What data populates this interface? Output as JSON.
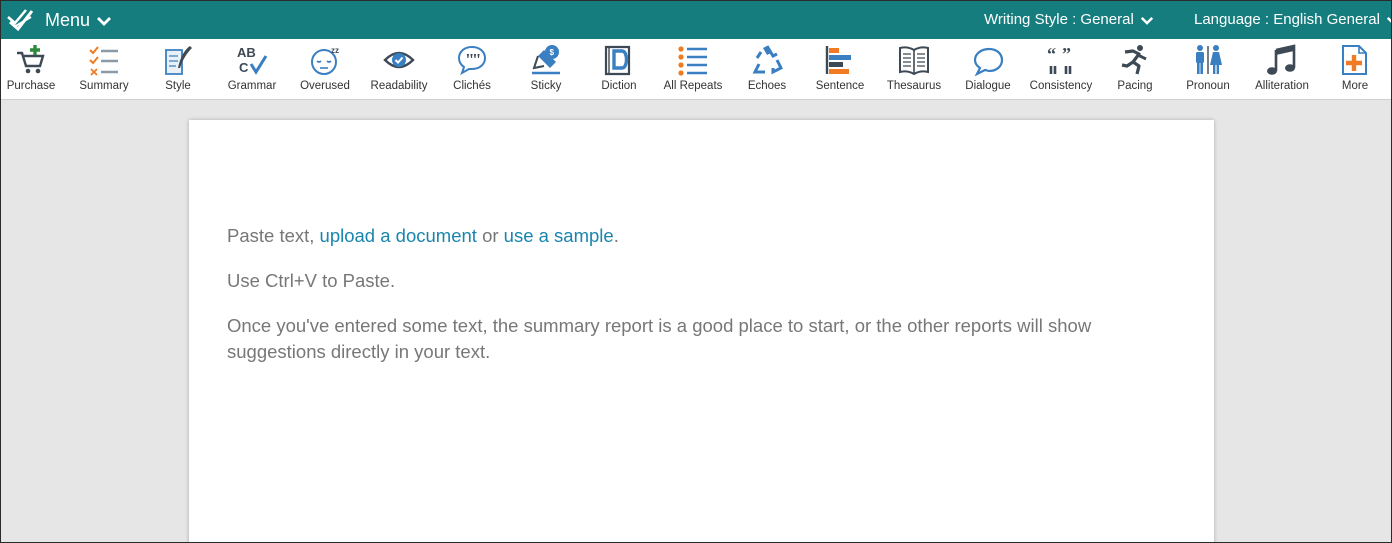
{
  "topbar": {
    "menu_label": "Menu",
    "writing_style_label": "Writing Style : General",
    "language_label": "Language : English General",
    "bar_color": "#167d7f"
  },
  "toolbar": {
    "items": [
      {
        "label": "Purchase",
        "icon": "cart-plus-icon"
      },
      {
        "label": "Summary",
        "icon": "checklist-icon"
      },
      {
        "label": "Style",
        "icon": "quill-page-icon"
      },
      {
        "label": "Grammar",
        "icon": "abc-check-icon"
      },
      {
        "label": "Overused",
        "icon": "sleepy-face-icon"
      },
      {
        "label": "Readability",
        "icon": "eye-icon"
      },
      {
        "label": "Clichés",
        "icon": "quote-bubble-icon"
      },
      {
        "label": "Sticky",
        "icon": "glue-pen-icon"
      },
      {
        "label": "Diction",
        "icon": "dictionary-book-icon"
      },
      {
        "label": "All Repeats",
        "icon": "list-icon"
      },
      {
        "label": "Echoes",
        "icon": "recycle-icon"
      },
      {
        "label": "Sentence",
        "icon": "bar-lines-icon"
      },
      {
        "label": "Thesaurus",
        "icon": "open-book-icon"
      },
      {
        "label": "Dialogue",
        "icon": "speech-bubble-icon"
      },
      {
        "label": "Consistency",
        "icon": "quote-marks-icon"
      },
      {
        "label": "Pacing",
        "icon": "runner-icon"
      },
      {
        "label": "Pronoun",
        "icon": "man-woman-icon"
      },
      {
        "label": "Alliteration",
        "icon": "music-note-icon"
      },
      {
        "label": "More",
        "icon": "add-page-icon"
      }
    ]
  },
  "document": {
    "line1_prefix": "Paste text,",
    "upload_link": "upload a document",
    "line1_or": "or",
    "sample_link": "use a sample",
    "line1_suffix": ".",
    "line2": "Use Ctrl+V to Paste.",
    "line3": "Once you've entered some text, the summary report is a good place to start, or the other reports will show suggestions directly in your text."
  },
  "colors": {
    "link": "#1a85ae",
    "accent_orange": "#f07b22",
    "icon_blue": "#3a7fc1",
    "icon_dark": "#3d4a55"
  }
}
